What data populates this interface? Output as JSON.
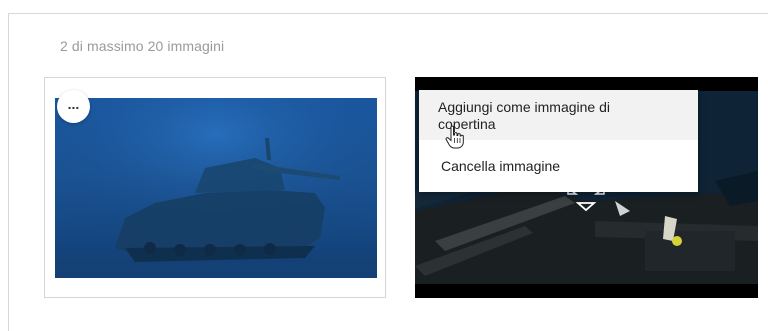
{
  "gallery": {
    "count_label": "2 di massimo 20 immagini",
    "images": [
      {
        "name": "immagine-1",
        "subject": "sunken tank underwater",
        "options_button": "..."
      },
      {
        "name": "immagine-2",
        "subject": "underwater wreck with diver"
      }
    ]
  },
  "context_menu": {
    "items": [
      {
        "label": "Aggiungi come immagine di copertina"
      },
      {
        "label": "Cancella immagine"
      }
    ]
  },
  "colors": {
    "water_blue": "#1a5aa6",
    "menu_hover": "#f2f2f2",
    "muted_text": "#9a9a9a"
  }
}
